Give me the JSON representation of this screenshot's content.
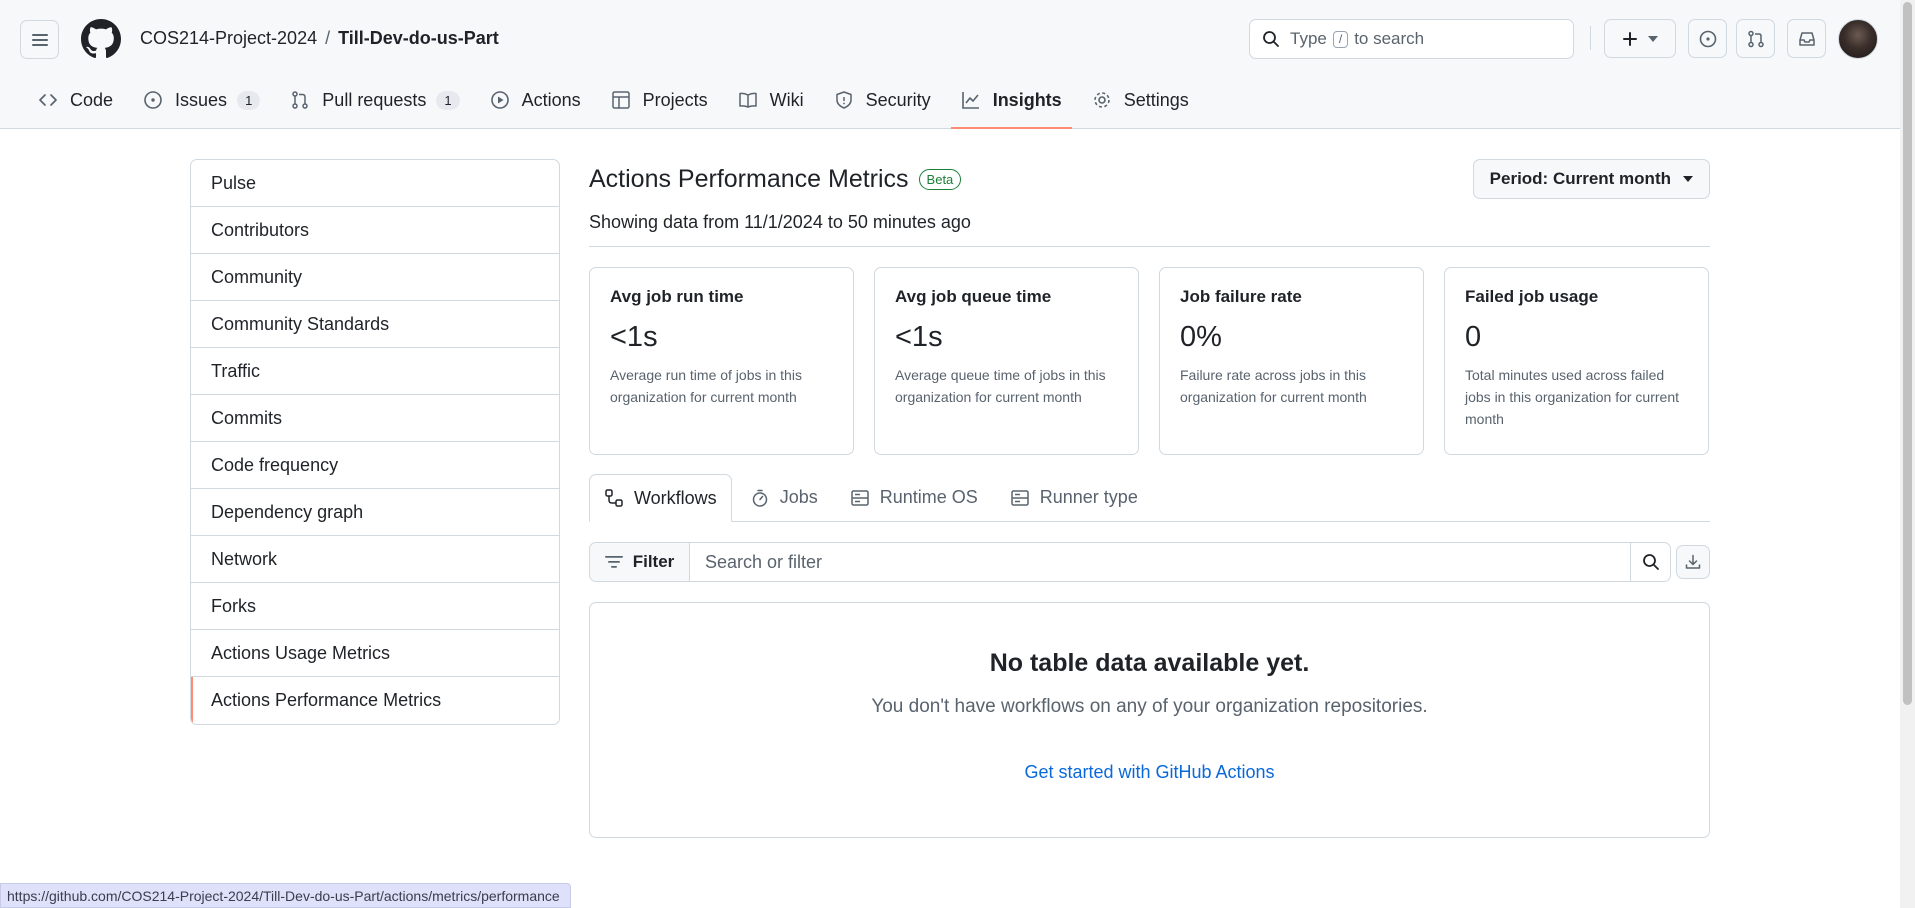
{
  "header": {
    "owner": "COS214-Project-2024",
    "separator": "/",
    "repo": "Till-Dev-do-us-Part",
    "search": {
      "prefix": "Type",
      "key": "/",
      "suffix": "to search"
    }
  },
  "repo_tabs": [
    {
      "label": "Code",
      "icon": "code-icon"
    },
    {
      "label": "Issues",
      "icon": "issue-opened-icon",
      "count": "1"
    },
    {
      "label": "Pull requests",
      "icon": "git-pull-request-icon",
      "count": "1"
    },
    {
      "label": "Actions",
      "icon": "play-icon"
    },
    {
      "label": "Projects",
      "icon": "table-icon"
    },
    {
      "label": "Wiki",
      "icon": "book-icon"
    },
    {
      "label": "Security",
      "icon": "shield-icon"
    },
    {
      "label": "Insights",
      "icon": "graph-icon",
      "active": true
    },
    {
      "label": "Settings",
      "icon": "gear-icon"
    }
  ],
  "sidebar": {
    "items": [
      {
        "label": "Pulse"
      },
      {
        "label": "Contributors"
      },
      {
        "label": "Community"
      },
      {
        "label": "Community Standards"
      },
      {
        "label": "Traffic"
      },
      {
        "label": "Commits"
      },
      {
        "label": "Code frequency"
      },
      {
        "label": "Dependency graph"
      },
      {
        "label": "Network"
      },
      {
        "label": "Forks"
      },
      {
        "label": "Actions Usage Metrics"
      },
      {
        "label": "Actions Performance Metrics",
        "selected": true
      }
    ]
  },
  "main": {
    "title": "Actions Performance Metrics",
    "badge": "Beta",
    "period_button": "Period: Current month",
    "subtitle": "Showing data from 11/1/2024 to 50 minutes ago",
    "cards": [
      {
        "title": "Avg job run time",
        "value": "<1s",
        "description": "Average run time of jobs in this organization for current month"
      },
      {
        "title": "Avg job queue time",
        "value": "<1s",
        "description": "Average queue time of jobs in this organization for current month"
      },
      {
        "title": "Job failure rate",
        "value": "0%",
        "description": "Failure rate across jobs in this organization for current month"
      },
      {
        "title": "Failed job usage",
        "value": "0",
        "description": "Total minutes used across failed jobs in this organization for current month"
      }
    ],
    "sub_tabs": [
      {
        "label": "Workflows",
        "icon": "workflow-icon",
        "active": true
      },
      {
        "label": "Jobs",
        "icon": "stopwatch-icon"
      },
      {
        "label": "Runtime OS",
        "icon": "server-icon"
      },
      {
        "label": "Runner type",
        "icon": "server-icon"
      }
    ],
    "filter": {
      "button": "Filter",
      "placeholder": "Search or filter"
    },
    "empty": {
      "title": "No table data available yet.",
      "description": "You don't have workflows on any of your organization repositories.",
      "link": "Get started with GitHub Actions"
    }
  },
  "status_bar": {
    "url": "https://github.com/COS214-Project-2024/Till-Dev-do-us-Part/actions/metrics/performance"
  },
  "colors": {
    "accent_underline": "#fd8c73",
    "link": "#0969da",
    "beta": "#1a7f37"
  }
}
